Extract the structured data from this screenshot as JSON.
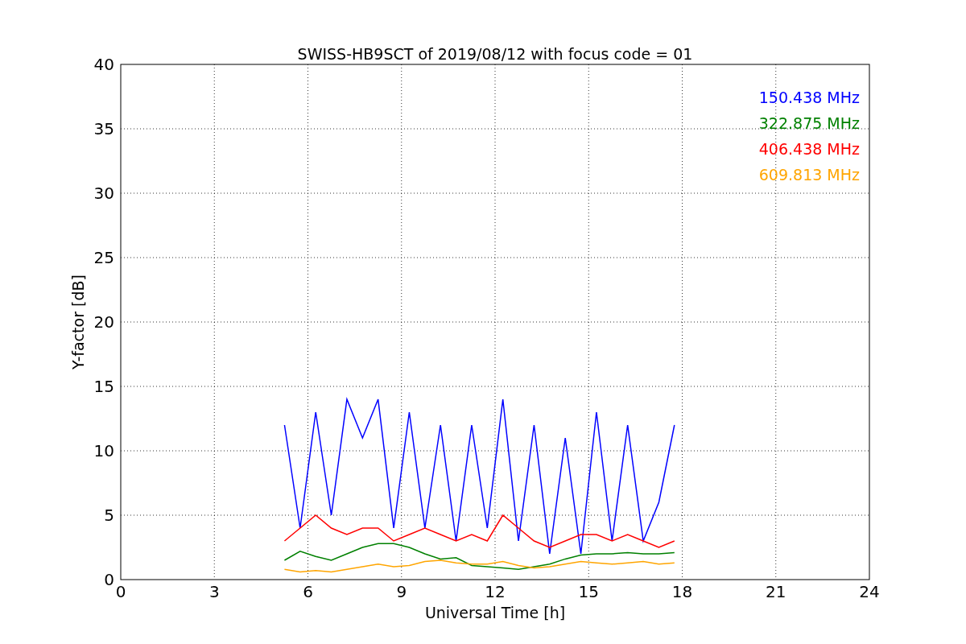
{
  "chart_data": {
    "type": "line",
    "title": "SWISS-HB9SCT of 2019/08/12 with focus code = 01",
    "xlabel": "Universal Time [h]",
    "ylabel": "Y-factor [dB]",
    "x": [
      5.25,
      5.75,
      6.25,
      6.75,
      7.25,
      7.75,
      8.25,
      8.75,
      9.25,
      9.75,
      10.25,
      10.75,
      11.25,
      11.75,
      12.25,
      12.75,
      13.25,
      13.75,
      14.25,
      14.75,
      15.25,
      15.75,
      16.25,
      16.75,
      17.25,
      17.75
    ],
    "series": [
      {
        "name": "150.438 MHz",
        "color": "#0000ff",
        "values": [
          12,
          4,
          13,
          5,
          14,
          11,
          14,
          4,
          13,
          4,
          12,
          3,
          12,
          4,
          14,
          3,
          12,
          2,
          11,
          2,
          13,
          3,
          12,
          3,
          6,
          12
        ]
      },
      {
        "name": "322.875 MHz",
        "color": "#008000",
        "values": [
          1.5,
          2.2,
          1.8,
          1.5,
          2,
          2.5,
          2.8,
          2.8,
          2.5,
          2,
          1.6,
          1.7,
          1.1,
          1,
          0.9,
          0.8,
          1,
          1.2,
          1.6,
          1.9,
          2,
          2,
          2.1,
          2,
          2,
          2.1
        ]
      },
      {
        "name": "406.438 MHz",
        "color": "#ff0000",
        "values": [
          3,
          4,
          5,
          4,
          3.5,
          4,
          4,
          3,
          3.5,
          4,
          3.5,
          3,
          3.5,
          3,
          5,
          4,
          3,
          2.5,
          3,
          3.5,
          3.5,
          3,
          3.5,
          3,
          2.5,
          3
        ]
      },
      {
        "name": "609.813 MHz",
        "color": "#ffa500",
        "values": [
          0.8,
          0.6,
          0.7,
          0.6,
          0.8,
          1,
          1.2,
          1,
          1.1,
          1.4,
          1.5,
          1.3,
          1.2,
          1.2,
          1.4,
          1.1,
          0.9,
          1,
          1.2,
          1.4,
          1.3,
          1.2,
          1.3,
          1.4,
          1.2,
          1.3
        ]
      }
    ],
    "xlim": [
      0,
      24
    ],
    "ylim": [
      0,
      40
    ],
    "xticks": [
      0,
      3,
      6,
      9,
      12,
      15,
      18,
      21,
      24
    ],
    "yticks": [
      0,
      5,
      10,
      15,
      20,
      25,
      30,
      35,
      40
    ],
    "grid": true
  }
}
